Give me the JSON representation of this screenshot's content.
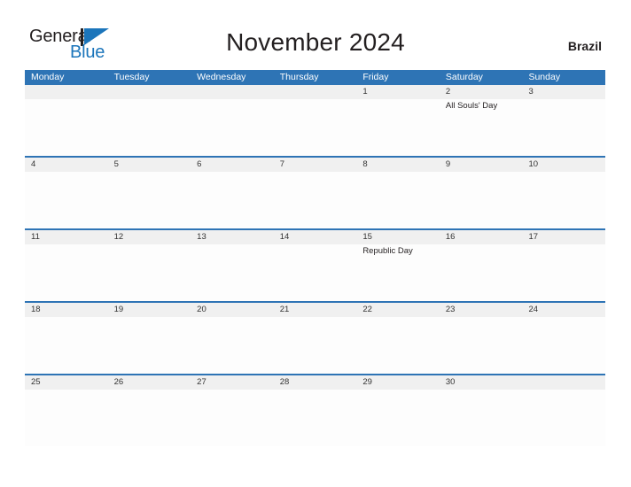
{
  "logo": {
    "word_one": "General",
    "word_two": "Blue",
    "triangle_color": "#1b75bb",
    "bar_color": "#231f20"
  },
  "header": {
    "title": "November 2024",
    "country": "Brazil",
    "accent_color": "#2e74b5",
    "band_color": "#f0f0f0"
  },
  "calendar": {
    "weekday_headers": [
      "Monday",
      "Tuesday",
      "Wednesday",
      "Thursday",
      "Friday",
      "Saturday",
      "Sunday"
    ],
    "weeks": [
      {
        "days": [
          {
            "date": "",
            "events": []
          },
          {
            "date": "",
            "events": []
          },
          {
            "date": "",
            "events": []
          },
          {
            "date": "",
            "events": []
          },
          {
            "date": "1",
            "events": []
          },
          {
            "date": "2",
            "events": [
              "All Souls' Day"
            ]
          },
          {
            "date": "3",
            "events": []
          }
        ]
      },
      {
        "days": [
          {
            "date": "4",
            "events": []
          },
          {
            "date": "5",
            "events": []
          },
          {
            "date": "6",
            "events": []
          },
          {
            "date": "7",
            "events": []
          },
          {
            "date": "8",
            "events": []
          },
          {
            "date": "9",
            "events": []
          },
          {
            "date": "10",
            "events": []
          }
        ]
      },
      {
        "days": [
          {
            "date": "11",
            "events": []
          },
          {
            "date": "12",
            "events": []
          },
          {
            "date": "13",
            "events": []
          },
          {
            "date": "14",
            "events": []
          },
          {
            "date": "15",
            "events": [
              "Republic Day"
            ]
          },
          {
            "date": "16",
            "events": []
          },
          {
            "date": "17",
            "events": []
          }
        ]
      },
      {
        "days": [
          {
            "date": "18",
            "events": []
          },
          {
            "date": "19",
            "events": []
          },
          {
            "date": "20",
            "events": []
          },
          {
            "date": "21",
            "events": []
          },
          {
            "date": "22",
            "events": []
          },
          {
            "date": "23",
            "events": []
          },
          {
            "date": "24",
            "events": []
          }
        ]
      },
      {
        "days": [
          {
            "date": "25",
            "events": []
          },
          {
            "date": "26",
            "events": []
          },
          {
            "date": "27",
            "events": []
          },
          {
            "date": "28",
            "events": []
          },
          {
            "date": "29",
            "events": []
          },
          {
            "date": "30",
            "events": []
          },
          {
            "date": "",
            "events": []
          }
        ]
      }
    ]
  }
}
